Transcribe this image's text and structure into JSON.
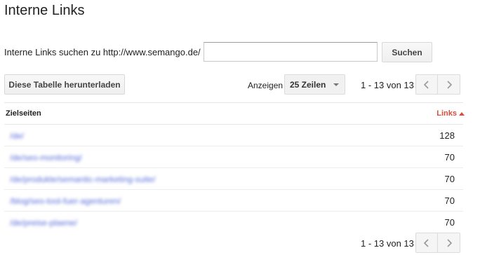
{
  "page": {
    "title": "Interne Links"
  },
  "search": {
    "label": "Interne Links suchen zu http://www.semango.de/",
    "placeholder": "",
    "button": "Suchen"
  },
  "toolbar": {
    "download_label": "Diese Tabelle herunterladen",
    "show_label": "Anzeigen",
    "rows_value": "25 Zeilen",
    "pager_text": "1 - 13 von 13"
  },
  "table": {
    "headers": {
      "target": "Zielseiten",
      "links": "Links"
    },
    "rows": [
      {
        "url": "/de/",
        "links": "128"
      },
      {
        "url": "/de/seo-monitoring/",
        "links": "70"
      },
      {
        "url": "/de/produkte/semantic-marketing-suite/",
        "links": "70"
      },
      {
        "url": "/blog/seo-tool-fuer-agenturen/",
        "links": "70"
      },
      {
        "url": "/de/preise-plaene/",
        "links": "70"
      }
    ]
  },
  "footer": {
    "pager_text": "1 - 13 von 13"
  },
  "colors": {
    "accent": "#dd4b39",
    "link": "#5a6fd8"
  }
}
